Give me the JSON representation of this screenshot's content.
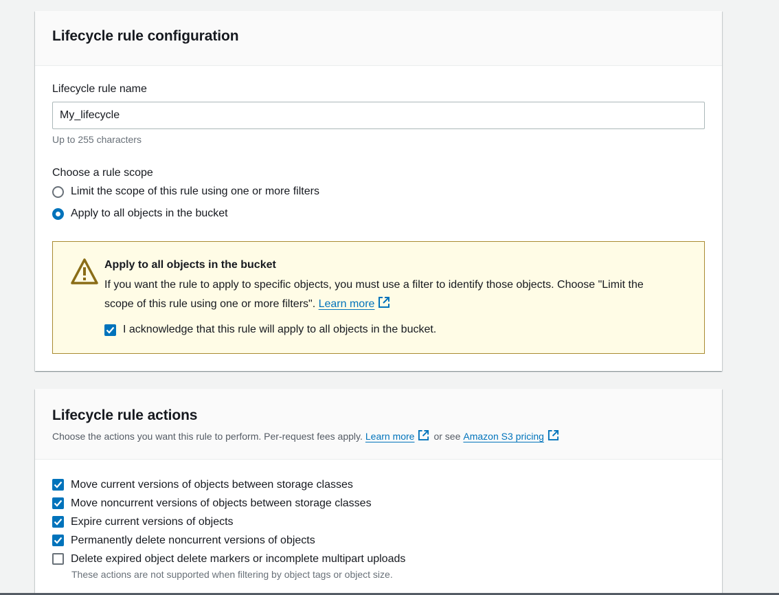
{
  "config_panel": {
    "title": "Lifecycle rule configuration",
    "name_label": "Lifecycle rule name",
    "name_value": "My_lifecycle",
    "name_hint": "Up to 255 characters",
    "scope_label": "Choose a rule scope",
    "scope_options": [
      {
        "label": "Limit the scope of this rule using one or more filters",
        "selected": false
      },
      {
        "label": "Apply to all objects in the bucket",
        "selected": true
      }
    ],
    "alert": {
      "title": "Apply to all objects in the bucket",
      "text": "If you want the rule to apply to specific objects, you must use a filter to identify those objects. Choose \"Limit the scope of this rule using one or more filters\".",
      "link": "Learn more",
      "ack_label": "I acknowledge that this rule will apply to all objects in the bucket.",
      "ack_checked": true
    }
  },
  "actions_panel": {
    "title": "Lifecycle rule actions",
    "desc_prefix": "Choose the actions you want this rule to perform. Per-request fees apply.",
    "desc_link1": "Learn more",
    "desc_middle": "or see",
    "desc_link2": "Amazon S3 pricing",
    "actions": [
      {
        "label": "Move current versions of objects between storage classes",
        "checked": true
      },
      {
        "label": "Move noncurrent versions of objects between storage classes",
        "checked": true
      },
      {
        "label": "Expire current versions of objects",
        "checked": true
      },
      {
        "label": "Permanently delete noncurrent versions of objects",
        "checked": true
      },
      {
        "label": "Delete expired object delete markers or incomplete multipart uploads",
        "checked": false
      }
    ],
    "actions_hint": "These actions are not supported when filtering by object tags or object size."
  },
  "colors": {
    "accent": "#0073bb",
    "warning_bg": "#fffce6",
    "warning_border": "#a88a30"
  }
}
